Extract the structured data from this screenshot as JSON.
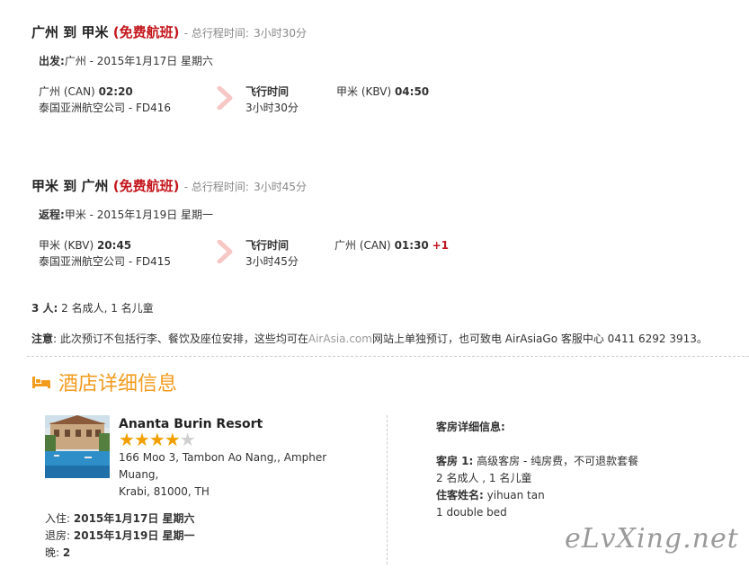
{
  "outbound": {
    "title_from": "广州",
    "title_to_word": "到",
    "title_to": "甲米",
    "free_label": "(免费航班)",
    "total_label": "- 总行程时间:",
    "total_value": "3小时30分",
    "depart_prefix": "出发:",
    "depart_text": "广州 - 2015年1月17日 星期六",
    "dep_airport": "广州 (CAN)",
    "dep_time": "02:20",
    "airline": "泰国亚洲航空公司 - FD416",
    "flight_time_label": "飞行时间",
    "flight_time_value": "3小时30分",
    "arr_airport": "甲米 (KBV)",
    "arr_time": "04:50"
  },
  "return": {
    "title_from": "甲米",
    "title_to_word": "到",
    "title_to": "广州",
    "free_label": "(免费航班)",
    "total_label": "- 总行程时间:",
    "total_value": "3小时45分",
    "depart_prefix": "返程:",
    "depart_text": "甲米 - 2015年1月19日 星期一",
    "dep_airport": "甲米 (KBV)",
    "dep_time": "20:45",
    "airline": "泰国亚洲航空公司 - FD415",
    "flight_time_label": "飞行时间",
    "flight_time_value": "3小时45分",
    "arr_airport": "广州 (CAN)",
    "arr_time": "01:30",
    "arr_day_offset": "+1"
  },
  "passengers": {
    "label": "3 人:",
    "value": "2 名成人, 1 名儿童"
  },
  "notice": {
    "label": "注意",
    "text_1": ": 此次预订不包括行李、餐饮及座位安排，这些均可在",
    "link": "AirAsia.com",
    "text_2": "网站上单独预订，也可致电 AirAsiaGo 客服中心 0411 6292 3913。"
  },
  "hotel_section": {
    "icon": "bed-icon",
    "title": "酒店详细信息"
  },
  "hotel": {
    "name": "Ananta Burin Resort",
    "stars_filled": 4,
    "stars_total": 5,
    "address_1": "166 Moo 3, Tambon Ao Nang,, Ampher",
    "address_2": "Muang,",
    "address_3": "Krabi, 81000, TH",
    "checkin_label": "入住:",
    "checkin_value": "2015年1月17日 星期六",
    "checkout_label": "退房:",
    "checkout_value": "2015年1月19日 星期一",
    "nights_label": "晚:",
    "nights_value": "2"
  },
  "room": {
    "header": "客房详细信息:",
    "room_label": "客房 1:",
    "room_value": "高级客房 - 纯房费，不可退款套餐",
    "guests": "2 名成人 , 1 名儿童",
    "guest_name_label": "住客姓名:",
    "guest_name_value": "yihuan tan",
    "bed": "1 double bed"
  },
  "watermark": "eLvXing.net",
  "colors": {
    "accent_red": "#c4161c",
    "hotel_orange": "#f29b1d",
    "star_gold": "#f2a000",
    "chevron_pink": "#f6c7c4"
  }
}
